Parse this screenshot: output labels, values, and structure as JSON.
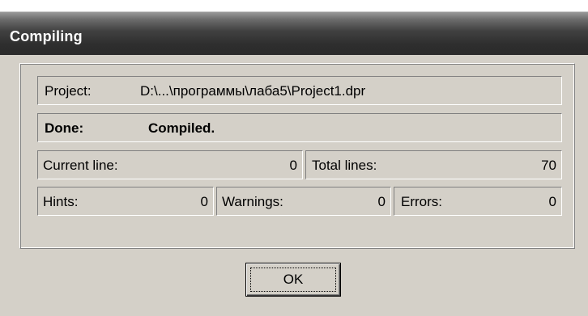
{
  "window": {
    "title": "Compiling"
  },
  "project": {
    "label": "Project:",
    "value": "D:\\...\\программы\\лаба5\\Project1.dpr"
  },
  "status": {
    "label": "Done:",
    "value": "Compiled."
  },
  "lines": {
    "current_label": "Current line:",
    "current_value": "0",
    "total_label": "Total lines:",
    "total_value": "70"
  },
  "messages": {
    "hints_label": "Hints:",
    "hints_value": "0",
    "warnings_label": "Warnings:",
    "warnings_value": "0",
    "errors_label": "Errors:",
    "errors_value": "0"
  },
  "buttons": {
    "ok_label": "OK"
  }
}
